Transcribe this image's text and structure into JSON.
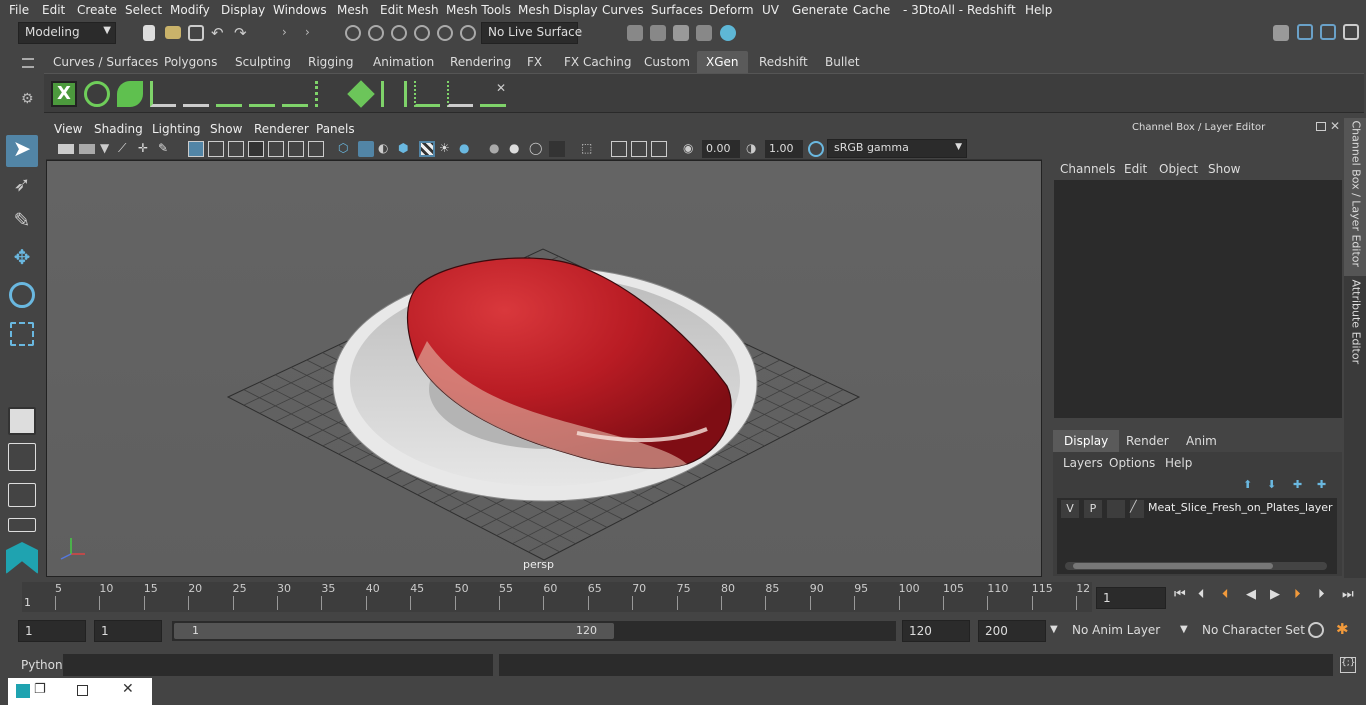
{
  "menu": [
    "File",
    "Edit",
    "Create",
    "Select",
    "Modify",
    "Display",
    "Windows",
    "Mesh",
    "Edit Mesh",
    "Mesh Tools",
    "Mesh Display",
    "Curves",
    "Surfaces",
    "Deform",
    "UV",
    "Generate",
    "Cache",
    "- 3DtoAll -",
    "Redshift",
    "Help"
  ],
  "status": {
    "workspace": "Modeling",
    "live_surface": "No Live Surface"
  },
  "shelf_tabs": [
    "Curves / Surfaces",
    "Polygons",
    "Sculpting",
    "Rigging",
    "Animation",
    "Rendering",
    "FX",
    "FX Caching",
    "Custom",
    "XGen",
    "Redshift",
    "Bullet"
  ],
  "shelf_active": "XGen",
  "panel_menu": [
    "View",
    "Shading",
    "Lighting",
    "Show",
    "Renderer",
    "Panels"
  ],
  "viewport": {
    "exposure": "0.00",
    "gamma": "1.00",
    "colorspace": "sRGB gamma",
    "camera_label": "persp"
  },
  "channel_box": {
    "title": "Channel Box / Layer Editor",
    "menu": [
      "Channels",
      "Edit",
      "Object",
      "Show"
    ]
  },
  "layer_editor": {
    "tabs": [
      "Display",
      "Render",
      "Anim"
    ],
    "active_tab": "Display",
    "menu": [
      "Layers",
      "Options",
      "Help"
    ],
    "layer": {
      "v": "V",
      "p": "P",
      "name": "Meat_Slice_Fresh_on_Plates_layer"
    }
  },
  "side_tabs": [
    "Channel Box / Layer Editor",
    "Attribute Editor"
  ],
  "timeline": {
    "ticks": [
      "5",
      "10",
      "15",
      "20",
      "25",
      "30",
      "35",
      "40",
      "45",
      "50",
      "55",
      "60",
      "65",
      "70",
      "75",
      "80",
      "85",
      "90",
      "95",
      "100",
      "105",
      "110",
      "115",
      "12"
    ],
    "start_label": "1",
    "current_frame": "1"
  },
  "range": {
    "start": "1",
    "start2": "1",
    "slider_start": "1",
    "slider_end": "120",
    "end": "120",
    "max_end": "200",
    "anim_layer": "No Anim Layer",
    "char_set": "No Character Set"
  },
  "cmd": {
    "label": "Python"
  },
  "colors": {
    "accent_blue": "#5285a6",
    "active_tab": "#5a5a5a",
    "meat_red": "#b01a22",
    "plate": "#d8d8d8"
  }
}
